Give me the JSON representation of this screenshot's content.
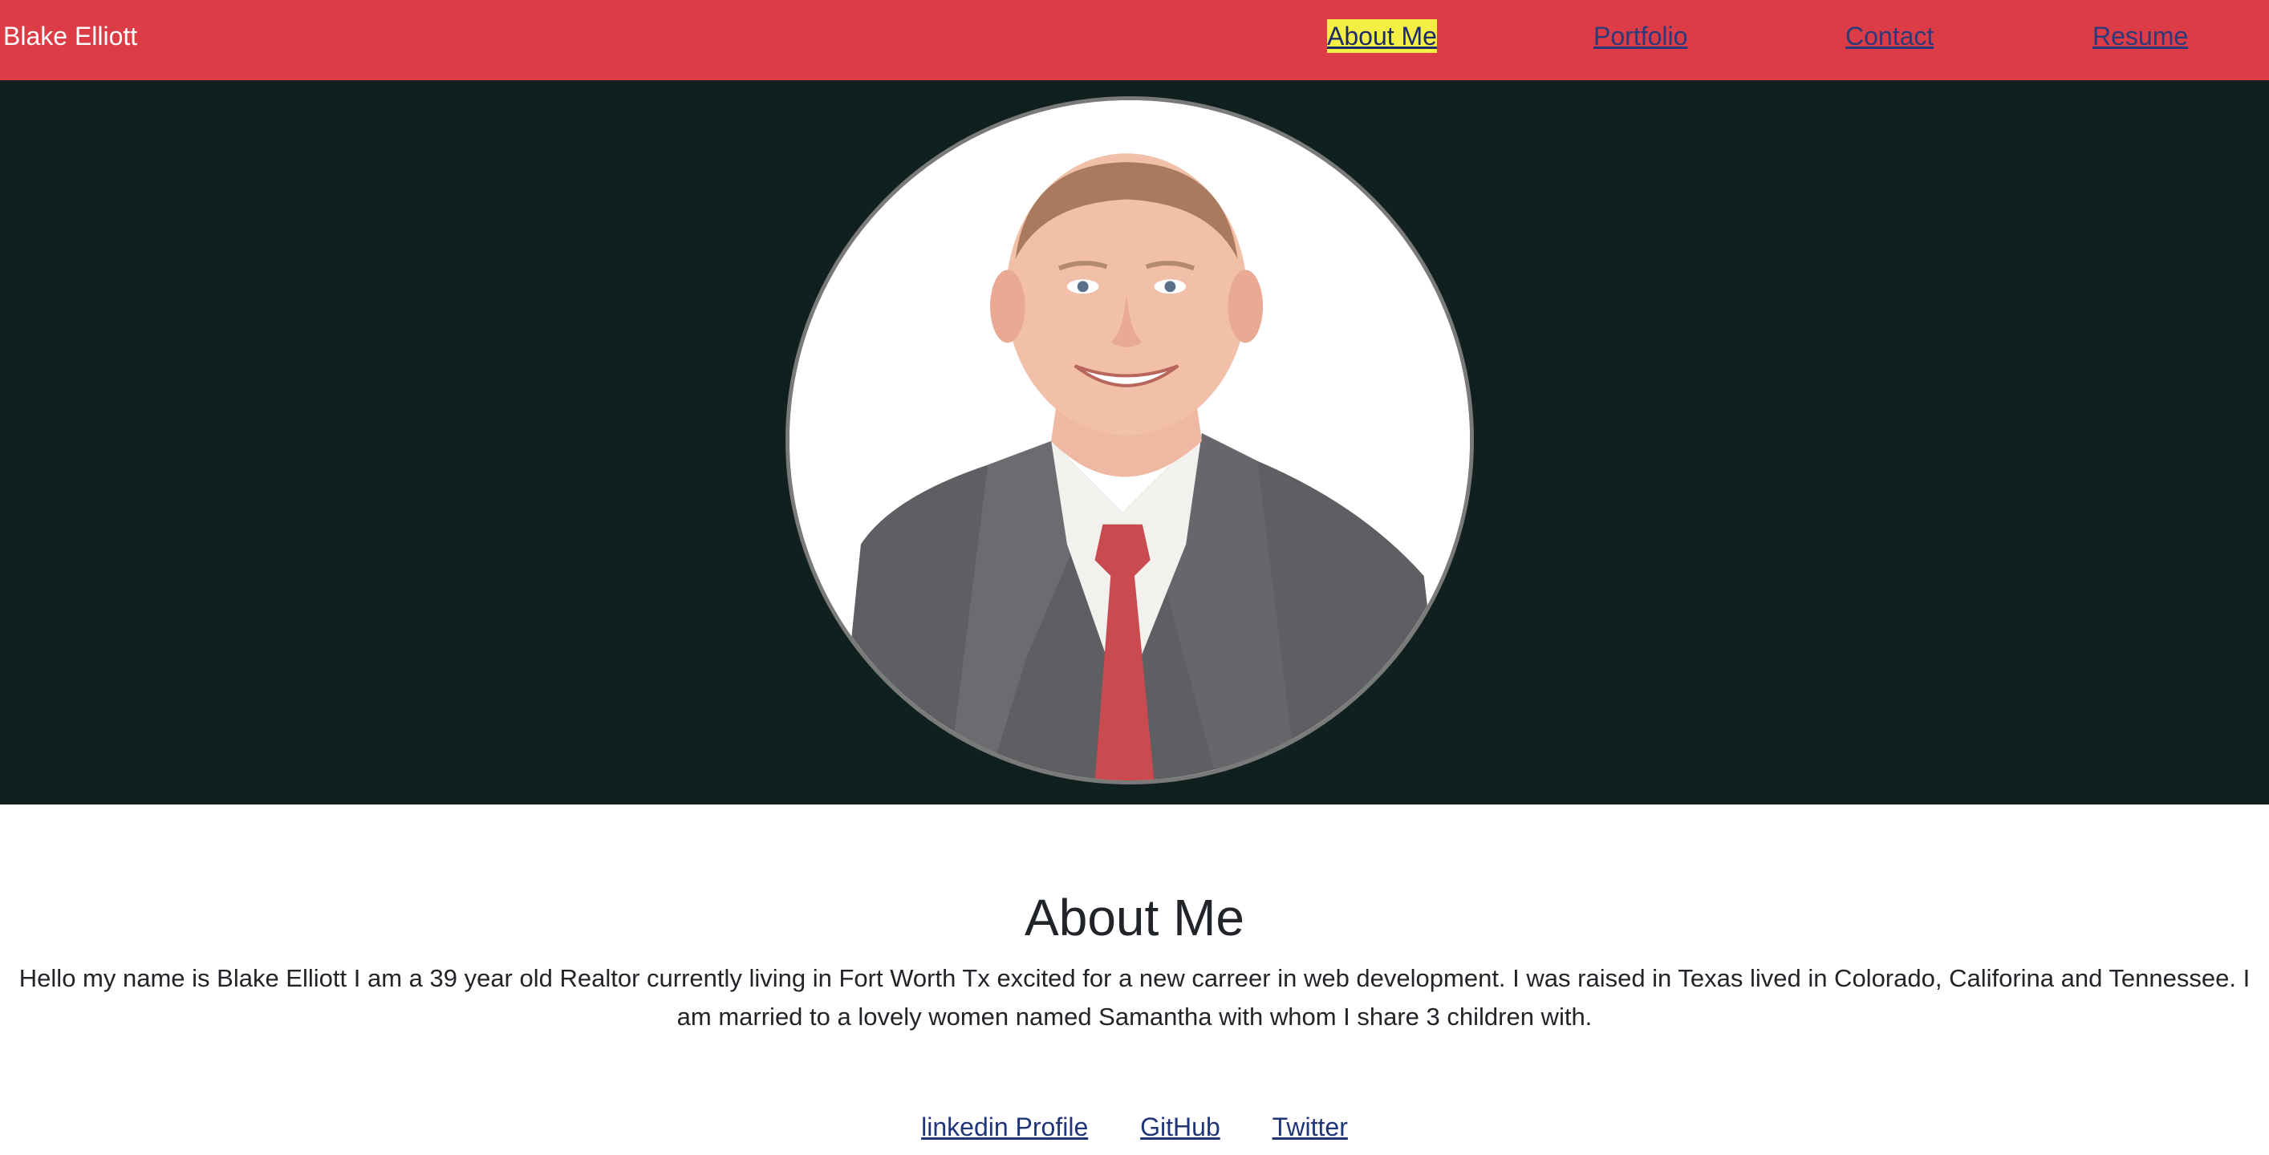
{
  "navbar": {
    "brand": "Blake Elliott",
    "links": [
      {
        "label": "About Me",
        "active": true
      },
      {
        "label": "Portfolio",
        "active": false
      },
      {
        "label": "Contact",
        "active": false
      },
      {
        "label": "Resume",
        "active": false
      }
    ]
  },
  "hero": {
    "photo_icon": "profile-photo"
  },
  "about": {
    "heading": "About Me",
    "text_line1": "Hello my name is Blake Elliott I am a 39 year old Realtor currently living in Fort Worth Tx excited for a new carreer in web development. I was raised in Texas lived in Colorado, Califorina and Tennessee. I",
    "text_line2": "am married to a lovely women named Samantha with whom I share 3 children with."
  },
  "social": {
    "links": [
      "linkedin Profile",
      "GitHub",
      "Twitter"
    ]
  },
  "colors": {
    "navbar_bg": "#dc3c46",
    "hero_bg": "#0f201f",
    "active_highlight": "#f4ef45",
    "link": "#2b3a7a"
  }
}
